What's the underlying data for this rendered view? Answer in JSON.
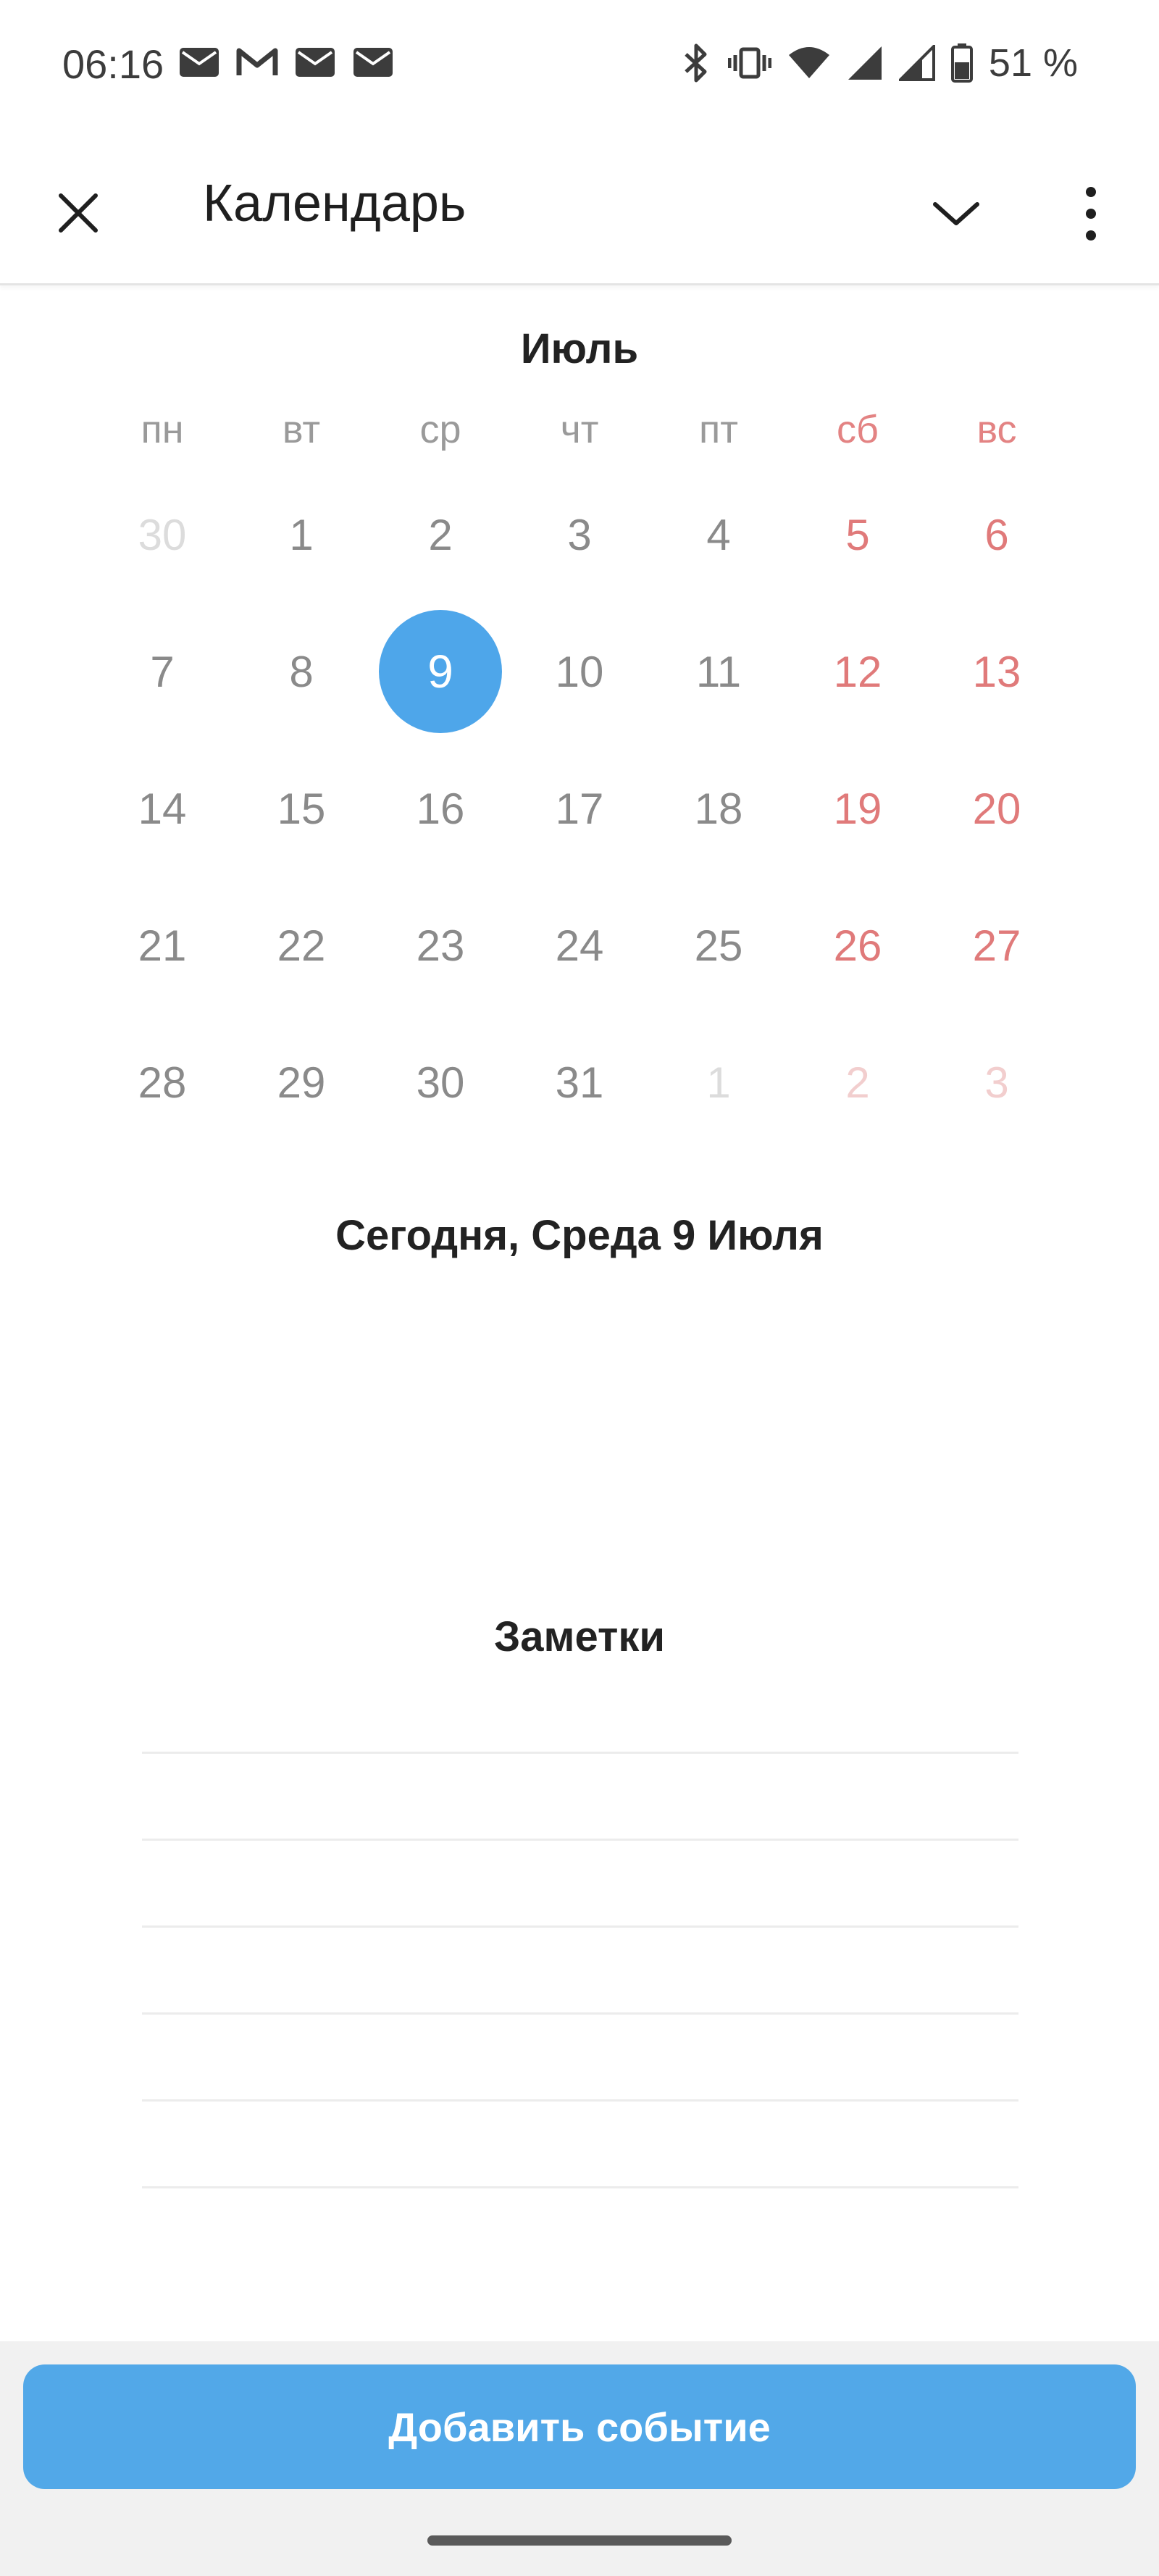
{
  "status_bar": {
    "time": "06:16",
    "battery": "51 %"
  },
  "app_bar": {
    "title": "Календарь"
  },
  "calendar": {
    "month": "Июль",
    "weekdays": [
      "пн",
      "вт",
      "ср",
      "чт",
      "пт",
      "сб",
      "вс"
    ],
    "weeks": [
      [
        "30",
        "1",
        "2",
        "3",
        "4",
        "5",
        "6"
      ],
      [
        "7",
        "8",
        "9",
        "10",
        "11",
        "12",
        "13"
      ],
      [
        "14",
        "15",
        "16",
        "17",
        "18",
        "19",
        "20"
      ],
      [
        "21",
        "22",
        "23",
        "24",
        "25",
        "26",
        "27"
      ],
      [
        "28",
        "29",
        "30",
        "31",
        "1",
        "2",
        "3"
      ]
    ],
    "selected_day": "9"
  },
  "today_label": "Сегодня, Среда 9 Июля",
  "notes": {
    "title": "Заметки"
  },
  "add_event_button": "Добавить событие",
  "colors": {
    "accent": "#52a8e8",
    "weekend": "#e07a7a"
  }
}
